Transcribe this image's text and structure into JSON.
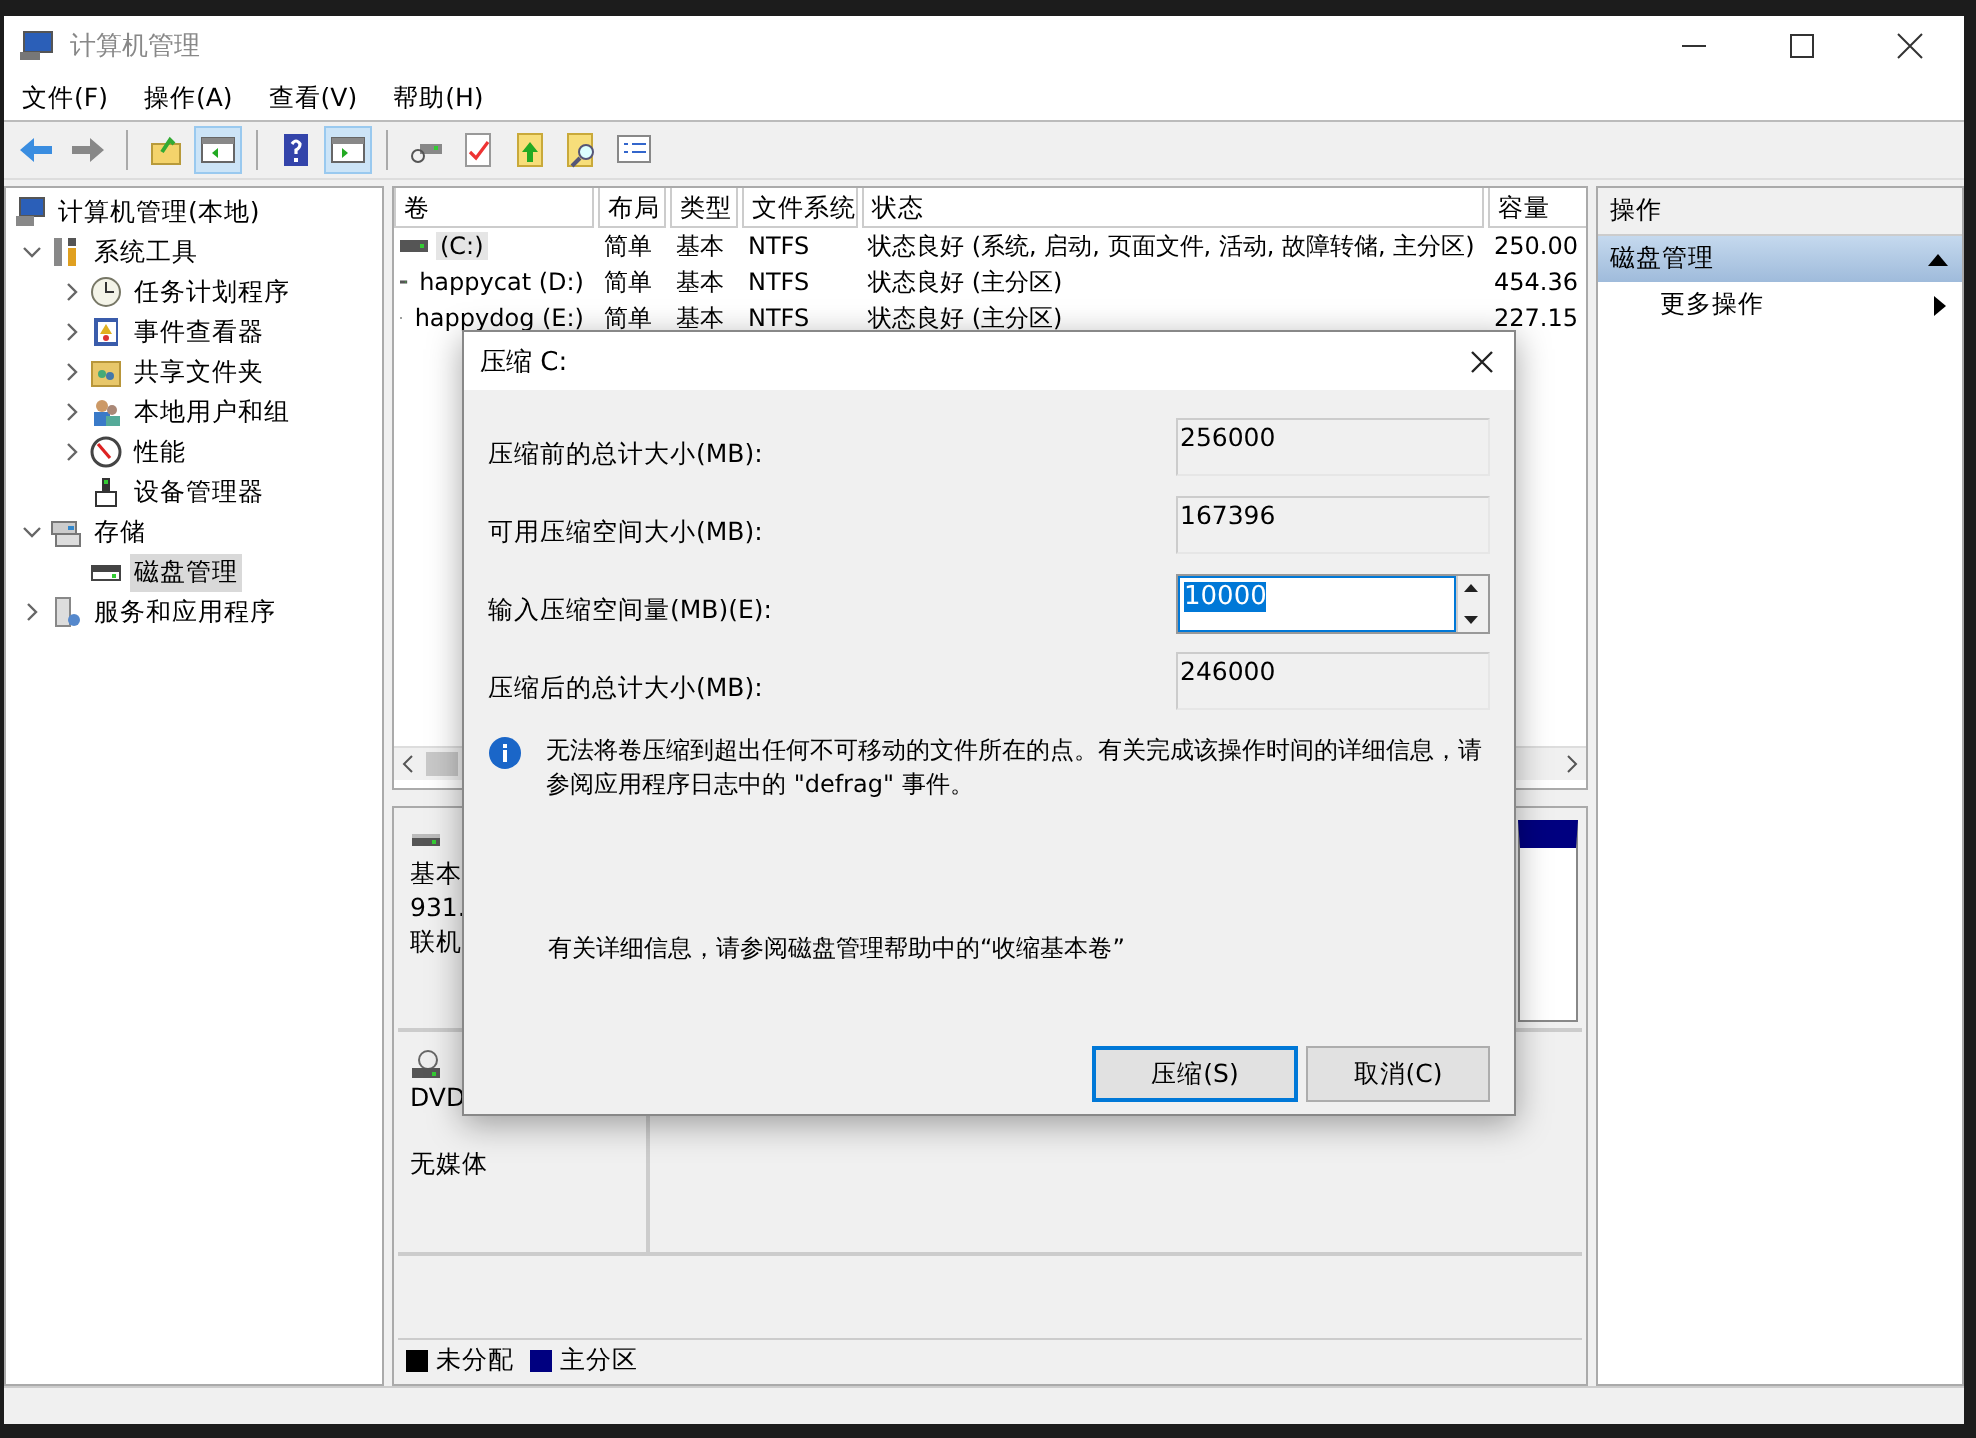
{
  "window": {
    "title": "计算机管理"
  },
  "menu": [
    "文件(F)",
    "操作(A)",
    "查看(V)",
    "帮助(H)"
  ],
  "toolbar": [
    {
      "pressed": false
    },
    {
      "pressed": false
    },
    {
      "pressed": false
    },
    {
      "pressed": true
    },
    {
      "pressed": false
    },
    {
      "pressed": true
    },
    {
      "pressed": false
    },
    {
      "pressed": false
    },
    {
      "pressed": false
    },
    {
      "pressed": false
    },
    {
      "pressed": false
    }
  ],
  "tree": [
    {
      "label": "计算机管理(本地)",
      "selected": false,
      "children": [
        {
          "label": "系统工具",
          "expanded": true,
          "selected": false,
          "children": [
            {
              "label": "任务计划程序",
              "expanded": false,
              "selected": false
            },
            {
              "label": "事件查看器",
              "expanded": false,
              "selected": false
            },
            {
              "label": "共享文件夹",
              "expanded": false,
              "selected": false
            },
            {
              "label": "本地用户和组",
              "expanded": false,
              "selected": false
            },
            {
              "label": "性能",
              "expanded": false,
              "selected": false
            },
            {
              "label": "设备管理器",
              "selected": false
            }
          ]
        },
        {
          "label": "存储",
          "expanded": true,
          "selected": false,
          "children": [
            {
              "label": "磁盘管理",
              "selected": true
            }
          ]
        },
        {
          "label": "服务和应用程序",
          "expanded": false,
          "selected": false
        }
      ]
    }
  ],
  "volume_table": {
    "columns": [
      "卷",
      "布局",
      "类型",
      "文件系统",
      "状态",
      "容量"
    ],
    "rows": [
      {
        "cells": [
          "(C:)",
          "简单",
          "基本",
          "NTFS",
          "状态良好 (系统, 启动, 页面文件, 活动, 故障转储, 主分区)",
          "250.00"
        ],
        "selected": true
      },
      {
        "cells": [
          "happycat (D:)",
          "简单",
          "基本",
          "NTFS",
          "状态良好 (主分区)",
          "454.36"
        ],
        "selected": false
      },
      {
        "cells": [
          "happydog (E:)",
          "简单",
          "基本",
          "NTFS",
          "状态良好 (主分区)",
          "227.15"
        ],
        "selected": false
      }
    ]
  },
  "disks": [
    {
      "kind": "disk",
      "lines": [
        "基本",
        "931.",
        "联机"
      ]
    },
    {
      "kind": "dvd",
      "lines": [
        "DVD",
        "无媒体"
      ]
    }
  ],
  "legend": [
    {
      "label": "未分配",
      "color": "#000000"
    },
    {
      "label": "主分区",
      "color": "#000080"
    }
  ],
  "actions": {
    "title": "操作",
    "sections": [
      {
        "label": "磁盘管理",
        "expanded": true,
        "items": [
          "更多操作"
        ]
      }
    ]
  },
  "dialog": {
    "title": "压缩 C:",
    "fields": [
      {
        "label": "压缩前的总计大小(MB):",
        "value": "256000",
        "kind": "readonly"
      },
      {
        "label": "可用压缩空间大小(MB):",
        "value": "167396",
        "kind": "readonly"
      },
      {
        "label": "输入压缩空间量(MB)(E):",
        "value": "10000",
        "kind": "spin"
      },
      {
        "label": "压缩后的总计大小(MB):",
        "value": "246000",
        "kind": "readonly"
      }
    ],
    "info": "无法将卷压缩到超出任何不可移动的文件所在的点。有关完成该操作时间的详细信息，请参阅应用程序日志中的 \"defrag\" 事件。",
    "help": "有关详细信息，请参阅磁盘管理帮助中的“收缩基本卷”",
    "buttons": [
      {
        "label": "压缩(S)",
        "default": true
      },
      {
        "label": "取消(C)",
        "default": false
      }
    ]
  }
}
